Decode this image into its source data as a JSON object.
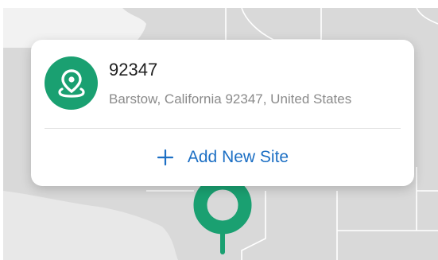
{
  "colors": {
    "accent_green": "#1aa071",
    "link_blue": "#1c6fc4",
    "map_land": "#d9d9d9",
    "map_border": "#ffffff"
  },
  "site": {
    "icon": "map-pin-icon",
    "title": "92347",
    "address": "Barstow, California 92347, United States"
  },
  "actions": {
    "add_icon": "plus-icon",
    "add_label": "Add New Site"
  },
  "map_marker": {
    "icon": "location-marker-icon"
  }
}
